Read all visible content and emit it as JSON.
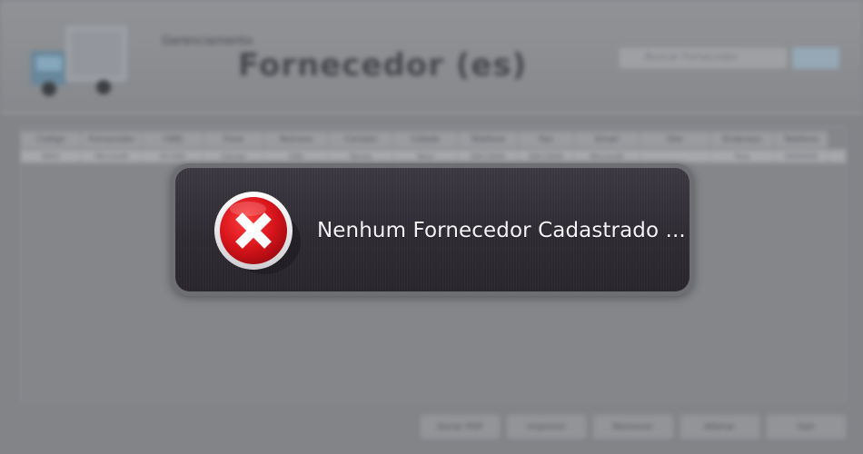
{
  "app": {
    "header": {
      "subtitle": "Gerenciamento",
      "title": "Fornecedor (es)",
      "search_placeholder": "Buscar Fornecedor",
      "search_button_label": "",
      "truck_icon": "truck-icon"
    },
    "grid": {
      "columns": [
        "Código",
        "Fornecedor",
        "CNPJ",
        "Fone",
        "Número",
        "Contato",
        "Cidade",
        "Telefone",
        "Fax",
        "Email",
        "Site",
        "Endereço",
        "Telefone"
      ],
      "row": [
        "0001",
        "Microsoft",
        "00.000",
        "Celular",
        "000",
        "Nome",
        "Tatuí",
        "000-0000",
        "000-0000",
        "Microsoft",
        "",
        "Rua",
        "0000000"
      ]
    },
    "footer": {
      "buttons": [
        "Gerar PDF",
        "Imprimir",
        "Remover",
        "Alterar",
        "Sair"
      ]
    }
  },
  "modal": {
    "message": "Nenhum Fornecedor Cadastrado ...",
    "icon": "error-x-icon",
    "colors": {
      "icon_red": "#d7141b",
      "panel": "#332f37",
      "border": "#6e6f72",
      "text": "#f4f4f6"
    }
  }
}
